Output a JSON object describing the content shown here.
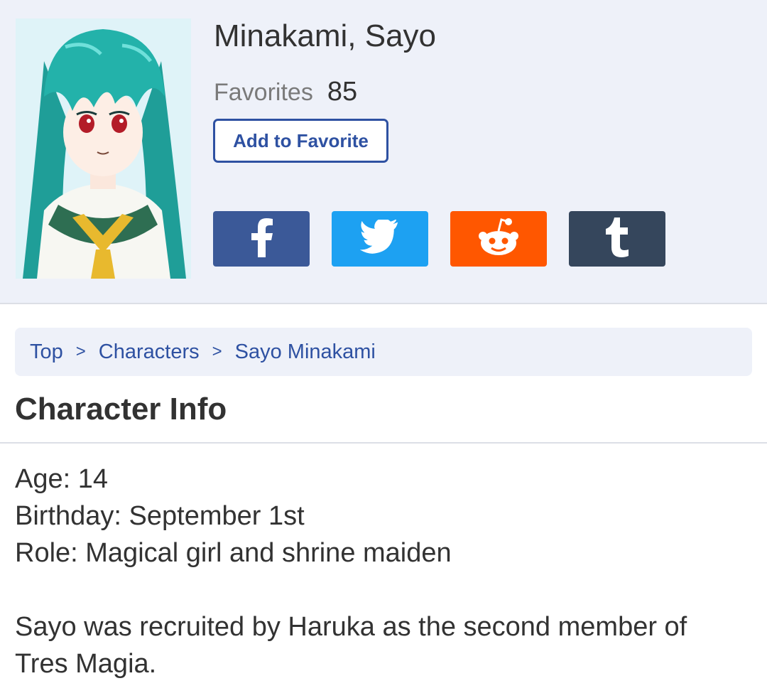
{
  "character": {
    "name": "Minakami, Sayo",
    "favorites_label": "Favorites",
    "favorites_count": "85",
    "add_favorite_label": "Add to Favorite"
  },
  "share": [
    {
      "name": "facebook",
      "icon": "facebook-icon",
      "color": "#3b5998"
    },
    {
      "name": "twitter",
      "icon": "twitter-icon",
      "color": "#1da1f2"
    },
    {
      "name": "reddit",
      "icon": "reddit-icon",
      "color": "#ff5700"
    },
    {
      "name": "tumblr",
      "icon": "tumblr-icon",
      "color": "#35465c"
    }
  ],
  "breadcrumb": {
    "items": [
      "Top",
      "Characters",
      "Sayo Minakami"
    ],
    "separator": ">"
  },
  "section": {
    "title": "Character Info"
  },
  "info": {
    "age": "Age: 14",
    "birthday": "Birthday: September 1st",
    "role": "Role: Magical girl and shrine maiden",
    "description_line1": "Sayo was recruited by Haruka as the second member of",
    "description_line2": "Tres Magia."
  },
  "colors": {
    "accent": "#2e51a2",
    "header_bg": "#eef1f9"
  }
}
